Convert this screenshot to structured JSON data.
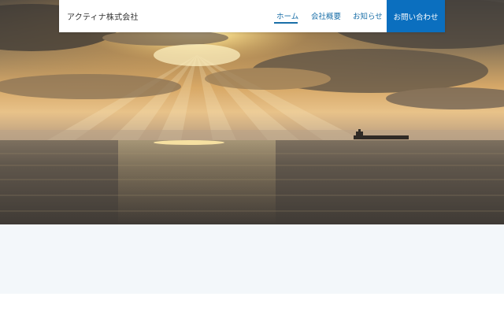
{
  "header": {
    "site_title": "アクティナ株式会社",
    "nav": {
      "home": "ホーム",
      "company": "会社概要",
      "news": "お知らせ",
      "contact": "お問い合わせ"
    }
  },
  "colors": {
    "accent": "#0b6fbf",
    "nav_text": "#1a6fa8",
    "band": "#f3f7fa"
  }
}
